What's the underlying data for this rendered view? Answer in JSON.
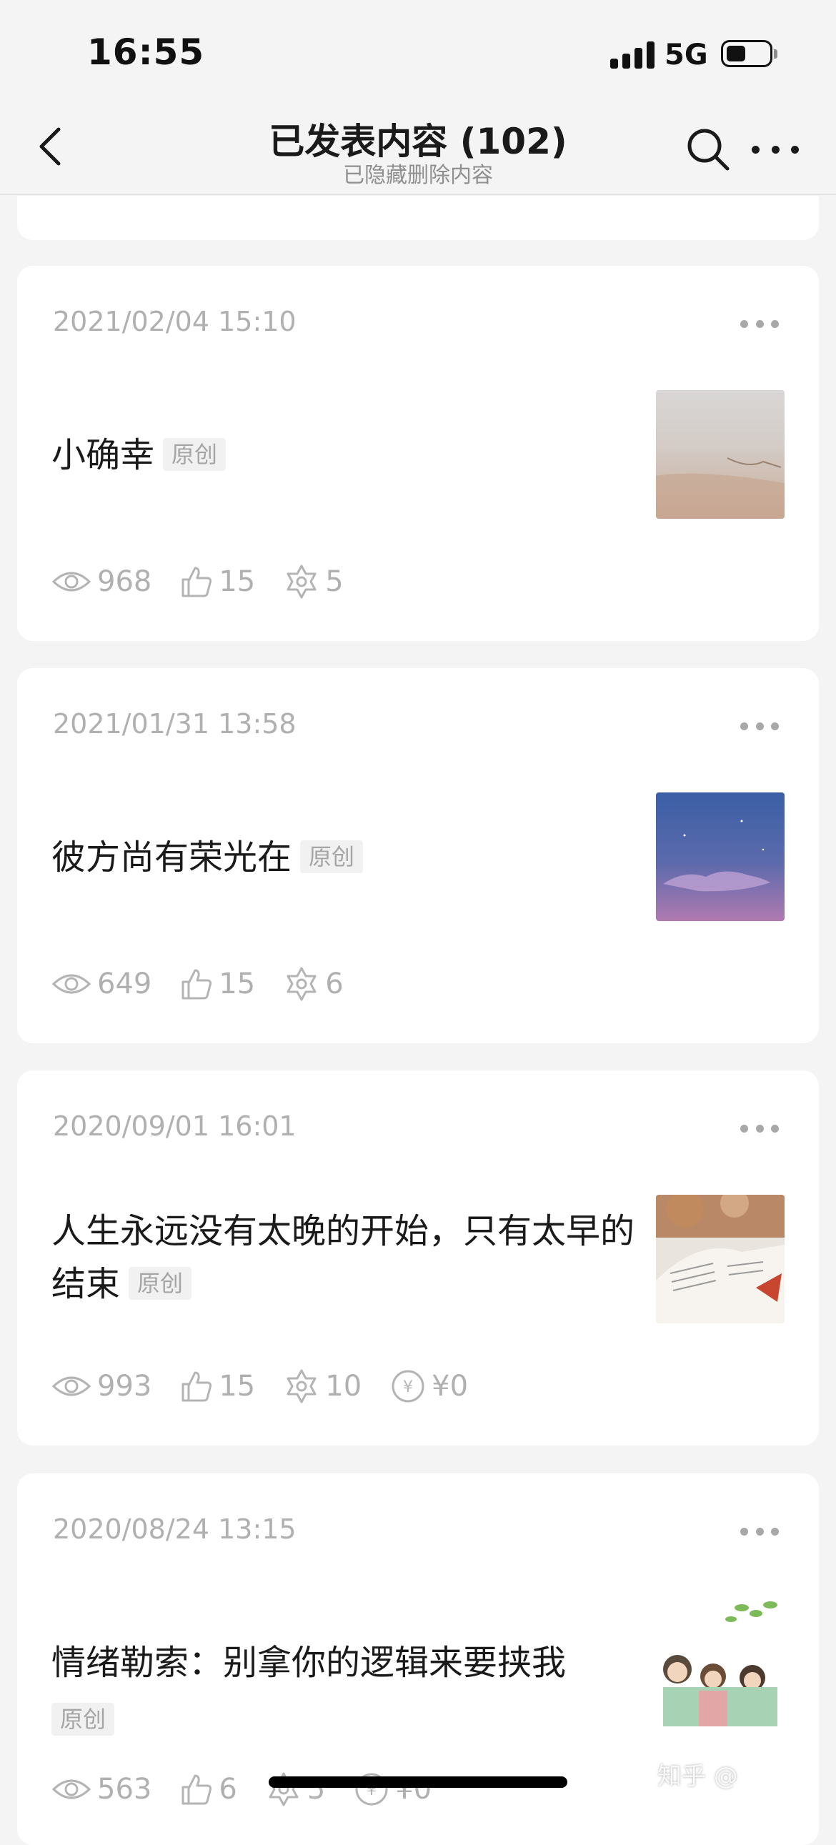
{
  "status_bar": {
    "time": "16:55",
    "network": "5G"
  },
  "nav": {
    "title": "已发表内容 (102)",
    "subtitle": "已隐藏删除内容",
    "back_icon": "chevron-left-icon",
    "search_icon": "search-icon",
    "more_icon": "more-horizontal-icon"
  },
  "posts": [
    {
      "date": "2021/02/04 15:10",
      "title": "小确幸",
      "badge": "原创",
      "views": "968",
      "likes": "15",
      "collections": "5"
    },
    {
      "date": "2021/01/31 13:58",
      "title": "彼方尚有荣光在",
      "badge": "原创",
      "views": "649",
      "likes": "15",
      "collections": "6"
    },
    {
      "date": "2020/09/01 16:01",
      "title": "人生永远没有太晚的开始，只有太早的结束",
      "badge": "原创",
      "views": "993",
      "likes": "15",
      "collections": "10",
      "income": "¥0"
    },
    {
      "date": "2020/08/24 13:15",
      "title": "情绪勒索：别拿你的逻辑来要挟我",
      "badge": "原创",
      "views": "563",
      "likes": "6",
      "collections": "5",
      "income": "¥0"
    }
  ],
  "watermark": "知乎 @"
}
